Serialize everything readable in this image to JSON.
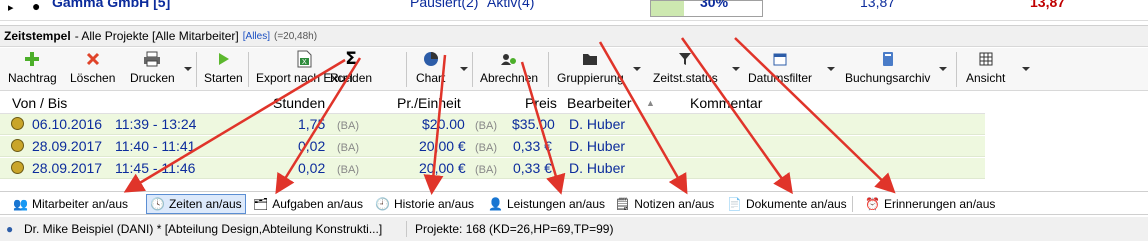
{
  "top_row": {
    "name": "Gamma GmbH [5]",
    "status": "Pausiert(2)",
    "active": "Aktiv(4)",
    "percent": "30%",
    "value1": "13,87",
    "value2": "13,87"
  },
  "title_bar": {
    "title": "Zeitstempel",
    "subtitle": "- Alle Projekte [Alle Mitarbeiter]",
    "badge": "[Alles]",
    "total": "(=20,48h)"
  },
  "toolbar": {
    "nachtrag": "Nachtrag",
    "loeschen": "Löschen",
    "drucken": "Drucken",
    "starten": "Starten",
    "export": "Export nach Excel",
    "runden": "Runden",
    "chart": "Chart",
    "abrechnen": "Abrechnen",
    "gruppierung": "Gruppierung",
    "zeitst_status": "Zeitst.status",
    "datumsfilter": "Datumsfilter",
    "buchungsarchiv": "Buchungsarchiv",
    "ansicht": "Ansicht"
  },
  "grid": {
    "columns": [
      "Von / Bis",
      "Stunden",
      "Pr./Einheit",
      "Preis",
      "Bearbeiter",
      "Kommentar"
    ],
    "rows": [
      {
        "date": "06.10.2016",
        "time": "11:39 - 13:24",
        "hours": "1,75",
        "ba1": "(BA)",
        "unit": "$20.00",
        "ba2": "(BA)",
        "price": "$35.00",
        "user": "D. Huber"
      },
      {
        "date": "28.09.2017",
        "time": "11:40 - 11:41",
        "hours": "0,02",
        "ba1": "(BA)",
        "unit": "20,00 €",
        "ba2": "(BA)",
        "price": "0,33 €",
        "user": "D. Huber"
      },
      {
        "date": "28.09.2017",
        "time": "11:45 - 11:46",
        "hours": "0,02",
        "ba1": "(BA)",
        "unit": "20,00 €",
        "ba2": "(BA)",
        "price": "0,33 €",
        "user": "D. Huber"
      }
    ]
  },
  "bottom_tabs": {
    "mitarbeiter": "Mitarbeiter an/aus",
    "zeiten": "Zeiten an/aus",
    "aufgaben": "Aufgaben an/aus",
    "historie": "Historie an/aus",
    "leistungen": "Leistungen an/aus",
    "notizen": "Notizen an/aus",
    "dokumente": "Dokumente an/aus",
    "erinnerungen": "Erinnerungen an/aus"
  },
  "status_bar": {
    "user": "Dr. Mike Beispiel (DANI) * [Abteilung Design,Abteilung Konstrukti...]",
    "projects": "Projekte: 168 (KD=26,HP=69,TP=99)"
  },
  "colors": {
    "row_bg": "#eef8df",
    "blue_text": "#0c2c9c",
    "red_text": "#c00000",
    "arrow": "#e0342a",
    "selected_tab": "#dce9fb"
  }
}
